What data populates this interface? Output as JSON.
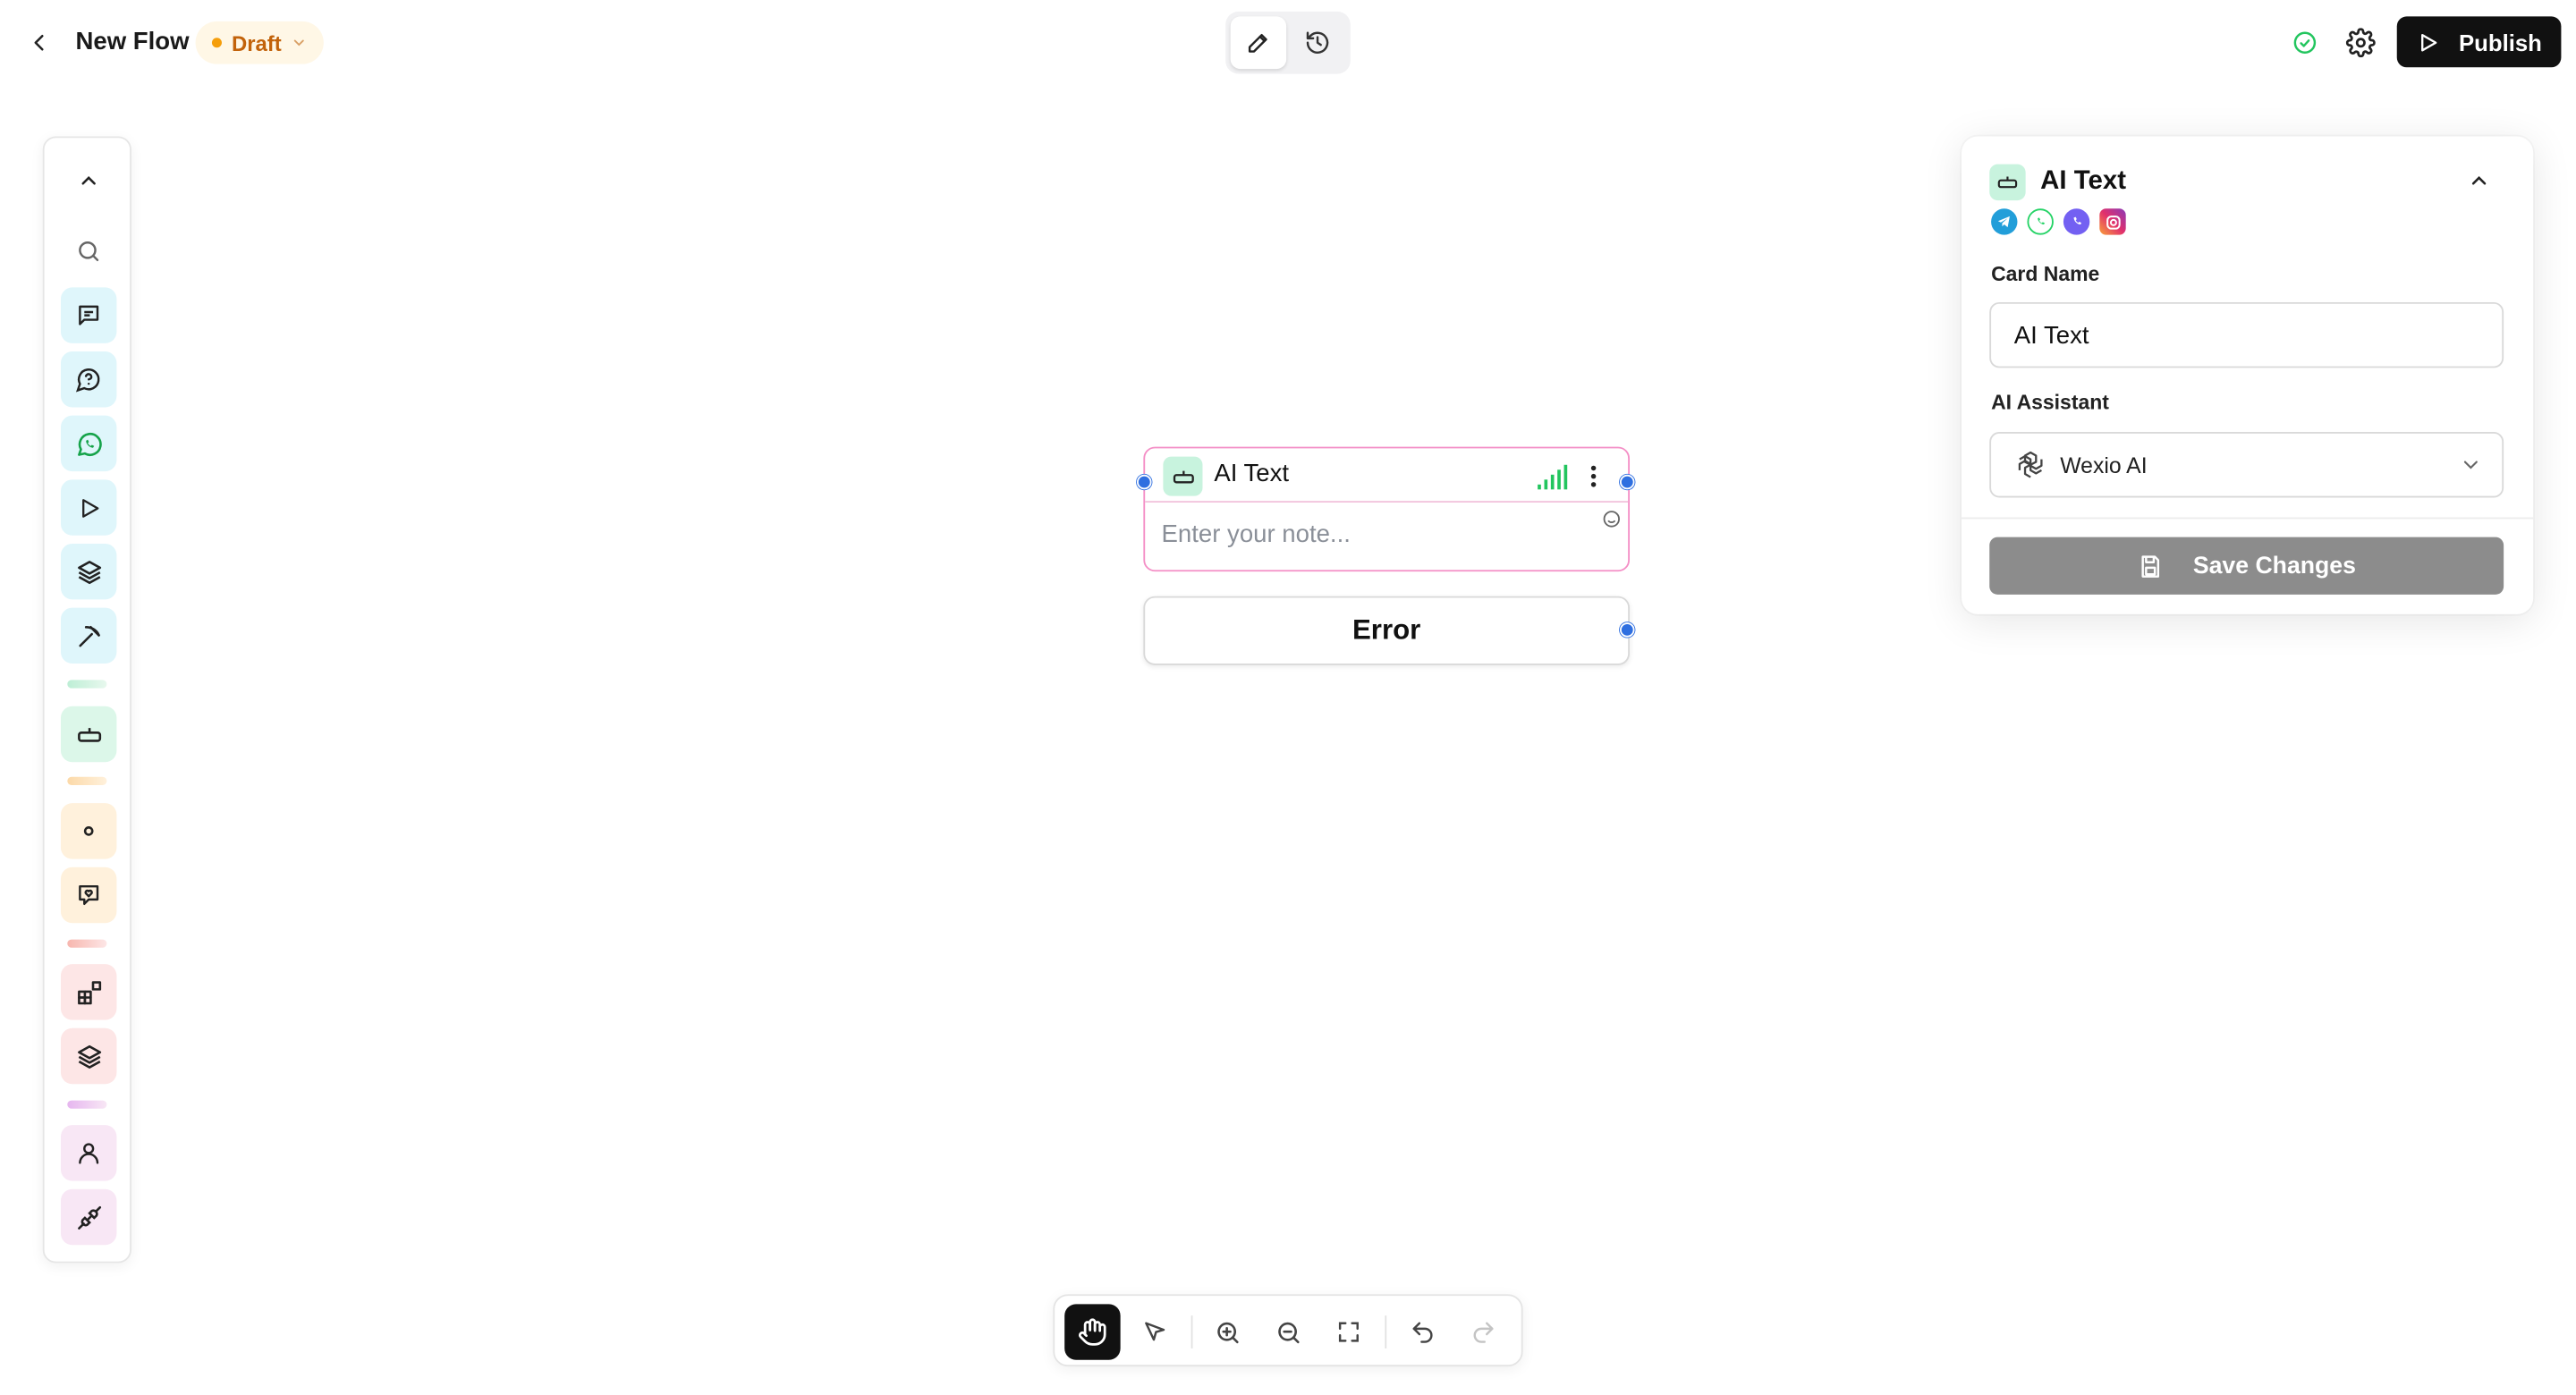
{
  "header": {
    "title": "New Flow",
    "status": "Draft",
    "publish_label": "Publish",
    "colors": {
      "draft_dot": "#f59e0b",
      "draft_text": "#c2620a",
      "status_ok": "#22c55e",
      "publish_bg": "#111111"
    }
  },
  "mode_toggle": {
    "items": [
      "edit",
      "history"
    ],
    "active": "edit"
  },
  "sidebar": {
    "items": [
      {
        "name": "collapse",
        "icon": "chevron-up-icon"
      },
      {
        "name": "search",
        "icon": "search-icon"
      },
      {
        "name": "message",
        "icon": "message-square-icon",
        "color": "#dff6fb"
      },
      {
        "name": "question",
        "icon": "message-question-icon",
        "color": "#dff6fb"
      },
      {
        "name": "whatsapp",
        "icon": "whatsapp-icon",
        "color": "#dff6fb"
      },
      {
        "name": "play",
        "icon": "play-icon",
        "color": "#dff6fb"
      },
      {
        "name": "layers",
        "icon": "layers-icon",
        "color": "#dff6fb"
      },
      {
        "name": "pick",
        "icon": "pickaxe-icon",
        "color": "#dff6fb"
      },
      {
        "name": "ai-text",
        "icon": "robot-icon",
        "color": "#dcf7e9"
      },
      {
        "name": "dot",
        "icon": "dot-icon",
        "color": "#fff1dc"
      },
      {
        "name": "chat-heart",
        "icon": "chat-heart-icon",
        "color": "#fff1dc"
      },
      {
        "name": "blocks",
        "icon": "blocks-icon",
        "color": "#fde6e6"
      },
      {
        "name": "layers-2",
        "icon": "layers-icon",
        "color": "#fde6e6"
      },
      {
        "name": "user",
        "icon": "user-icon",
        "color": "#f8e7f5"
      },
      {
        "name": "plug",
        "icon": "plug-icon",
        "color": "#f8e7f5"
      }
    ]
  },
  "node": {
    "title": "AI Text",
    "note_placeholder": "Enter your note...",
    "error_label": "Error"
  },
  "panel": {
    "title": "AI Text",
    "channels": [
      "telegram-icon",
      "whatsapp-icon",
      "viber-icon",
      "instagram-icon"
    ],
    "card_name_label": "Card Name",
    "card_name_value": "AI Text",
    "assistant_label": "AI Assistant",
    "assistant_value": "Wexio AI",
    "save_label": "Save Changes"
  },
  "toolbar": {
    "items": [
      "hand",
      "select",
      "zoom-in",
      "zoom-out",
      "fit",
      "undo",
      "redo"
    ],
    "active": "hand"
  }
}
